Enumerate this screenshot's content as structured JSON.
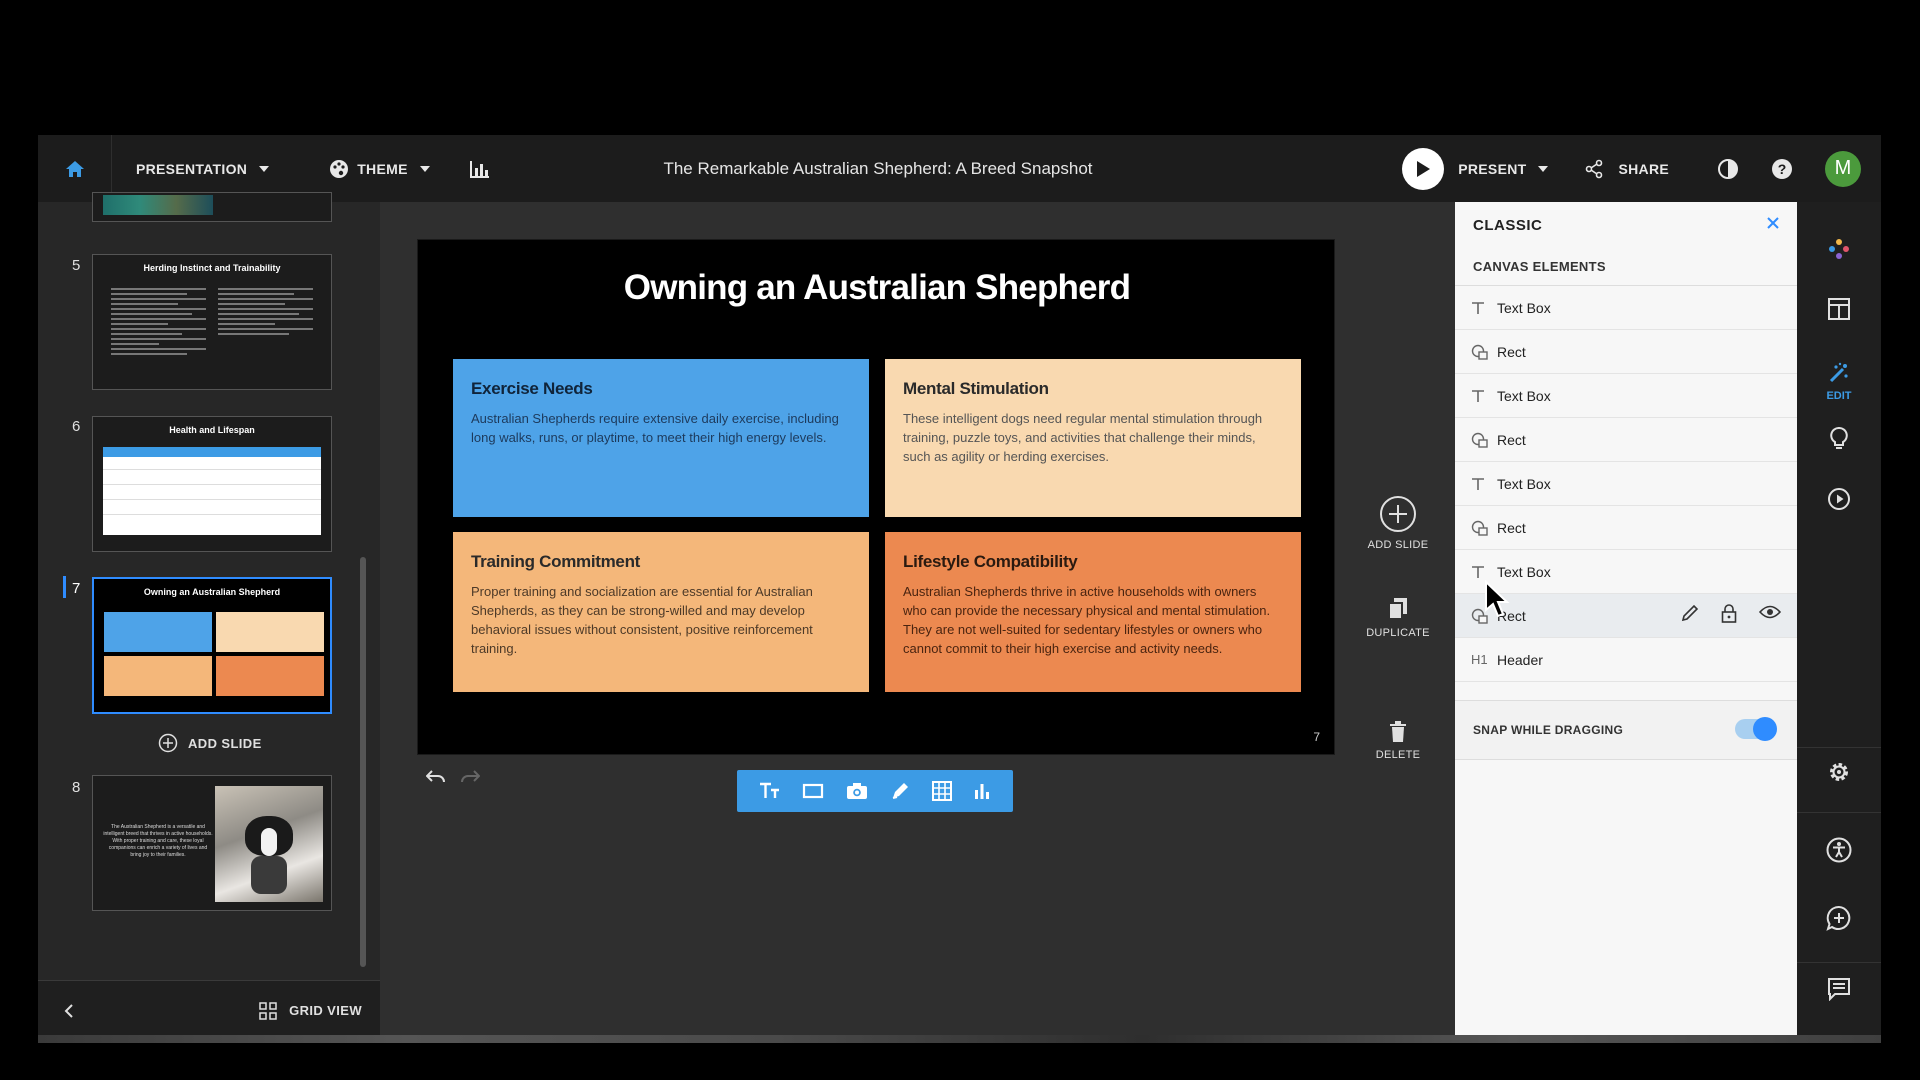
{
  "topbar": {
    "presentation_label": "PRESENTATION",
    "theme_label": "THEME",
    "doc_title": "The Remarkable Australian Shepherd: A Breed Snapshot",
    "present_label": "PRESENT",
    "share_label": "SHARE",
    "avatar_letter": "M"
  },
  "slide_panel": {
    "thumbs": [
      {
        "num": "5",
        "title": "Herding Instinct and Trainability"
      },
      {
        "num": "6",
        "title": "Health and Lifespan"
      },
      {
        "num": "7",
        "title": "Owning an Australian Shepherd"
      },
      {
        "num": "8",
        "text": "The Australian Shepherd is a versatile and intelligent breed that thrives in active households. With proper training and care, these loyal companions can enrich a variety of lives and bring joy to their families."
      }
    ],
    "add_slide_label": "ADD SLIDE",
    "grid_view_label": "GRID VIEW"
  },
  "slide": {
    "title": "Owning an Australian Shepherd",
    "number": "7",
    "cards": [
      {
        "title": "Exercise Needs",
        "body": "Australian Shepherds require extensive daily exercise, including long walks, runs, or playtime, to meet their high energy levels.",
        "bg": "#4ea3e8"
      },
      {
        "title": "Mental Stimulation",
        "body": "These intelligent dogs need regular mental stimulation through training, puzzle toys, and activities that challenge their minds, such as agility or herding exercises.",
        "bg": "#f9d9b0"
      },
      {
        "title": "Training Commitment",
        "body": "Proper training and socialization are essential for Australian Shepherds, as they can be strong-willed and may develop behavioral issues without consistent, positive reinforcement training.",
        "bg": "#f4b77a"
      },
      {
        "title": "Lifestyle Compatibility",
        "body": "Australian Shepherds thrive in active households with owners who can provide the necessary physical and mental stimulation. They are not well-suited for sedentary lifestyles or owners who cannot commit to their high exercise and activity needs.",
        "bg": "#ec8950"
      }
    ]
  },
  "canvas_actions": {
    "add_slide": "ADD SLIDE",
    "duplicate": "DUPLICATE",
    "delete": "DELETE"
  },
  "props": {
    "header": "CLASSIC",
    "section_title": "CANVAS ELEMENTS",
    "elements": [
      {
        "type": "T",
        "label": "Text Box"
      },
      {
        "type": "shape",
        "label": "Rect"
      },
      {
        "type": "T",
        "label": "Text Box"
      },
      {
        "type": "shape",
        "label": "Rect"
      },
      {
        "type": "T",
        "label": "Text Box"
      },
      {
        "type": "shape",
        "label": "Rect"
      },
      {
        "type": "T",
        "label": "Text Box"
      },
      {
        "type": "shape",
        "label": "Rect"
      },
      {
        "type": "H1",
        "label": "Header"
      }
    ],
    "snap_label": "SNAP WHILE DRAGGING",
    "snap_on": true
  },
  "rail": {
    "edit_label": "EDIT"
  },
  "colors": {
    "accent": "#2f8cff",
    "toolbar_blue": "#3c9be5"
  }
}
